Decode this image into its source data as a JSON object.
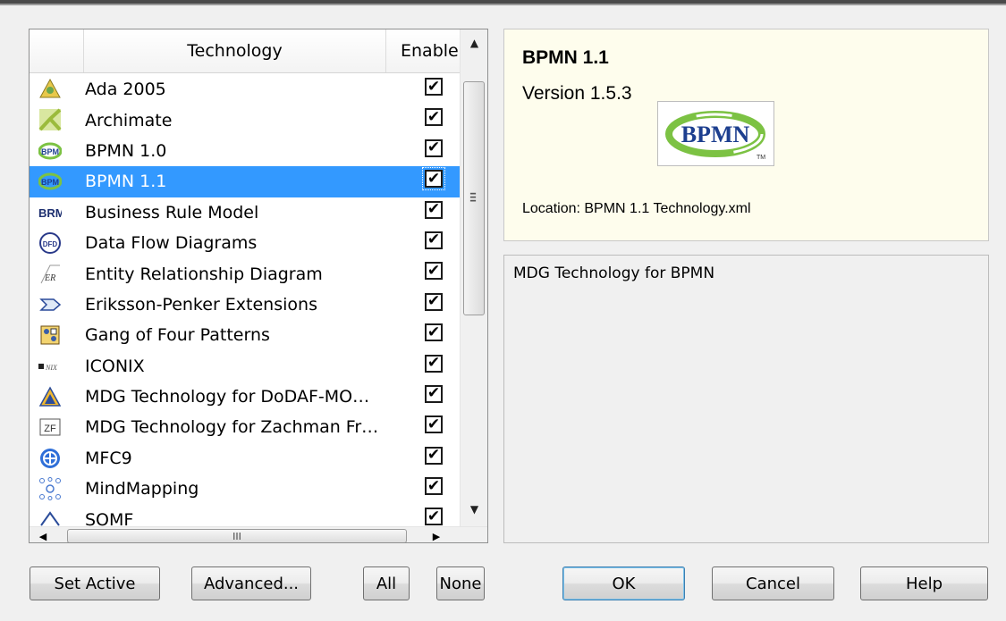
{
  "list": {
    "columns": {
      "blank": "",
      "technology": "Technology",
      "enabled": "Enable"
    },
    "rows": [
      {
        "icon": "ada-icon",
        "label": "Ada 2005",
        "checked": true,
        "selected": false
      },
      {
        "icon": "archimate-icon",
        "label": "Archimate",
        "checked": true,
        "selected": false
      },
      {
        "icon": "bpmn-icon",
        "label": "BPMN 1.0",
        "checked": true,
        "selected": false
      },
      {
        "icon": "bpmn-icon",
        "label": "BPMN 1.1",
        "checked": true,
        "selected": true
      },
      {
        "icon": "brm-icon",
        "label": "Business Rule Model",
        "checked": true,
        "selected": false
      },
      {
        "icon": "dfd-icon",
        "label": "Data Flow Diagrams",
        "checked": true,
        "selected": false
      },
      {
        "icon": "er-icon",
        "label": "Entity Relationship Diagram",
        "checked": true,
        "selected": false
      },
      {
        "icon": "arrow-icon",
        "label": "Eriksson-Penker Extensions",
        "checked": true,
        "selected": false
      },
      {
        "icon": "gof-icon",
        "label": "Gang of Four Patterns",
        "checked": true,
        "selected": false
      },
      {
        "icon": "iconix-icon",
        "label": "ICONIX",
        "checked": true,
        "selected": false
      },
      {
        "icon": "dodaf-icon",
        "label": "MDG Technology for DoDAF-MO…",
        "checked": true,
        "selected": false
      },
      {
        "icon": "zachman-icon",
        "label": "MDG Technology for Zachman Fr…",
        "checked": true,
        "selected": false
      },
      {
        "icon": "mfc-icon",
        "label": "MFC9",
        "checked": true,
        "selected": false
      },
      {
        "icon": "mindmap-icon",
        "label": "MindMapping",
        "checked": true,
        "selected": false
      },
      {
        "icon": "somf-icon",
        "label": "SOMF",
        "checked": true,
        "selected": false
      }
    ],
    "hscroll_grip": "III",
    "check_glyph": "✔"
  },
  "info": {
    "title": "BPMN 1.1",
    "version": "Version 1.5.3",
    "logo_text": "BPMN",
    "logo_tm": "TM",
    "location": "Location: BPMN 1.1 Technology.xml",
    "description": "MDG Technology for BPMN"
  },
  "buttons": {
    "set_active": "Set Active",
    "advanced": "Advanced...",
    "all": "All",
    "none": "None",
    "ok": "OK",
    "cancel": "Cancel",
    "help": "Help"
  },
  "colors": {
    "selection": "#3399ff",
    "info_background": "#fefded",
    "bpmn_green": "#7cc243",
    "bpmn_blue": "#1d3f8f"
  }
}
